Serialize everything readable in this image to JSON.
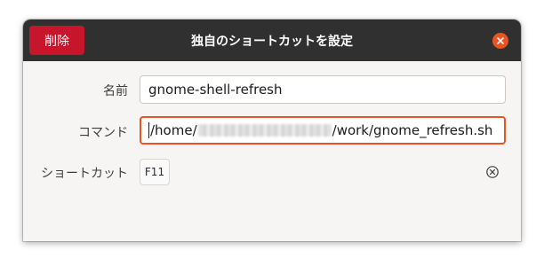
{
  "window": {
    "title": "独自のショートカットを設定",
    "delete_label": "削除"
  },
  "form": {
    "name_label": "名前",
    "name_value": "gnome-shell-refresh",
    "command_label": "コマンド",
    "command_prefix": "/home/",
    "command_suffix": "/work/gnome_refresh.sh",
    "shortcut_label": "ショートカット",
    "shortcut_value": "F11"
  },
  "colors": {
    "headerbar": "#303030",
    "destructive": "#c7162b",
    "accent": "#e95420"
  },
  "icons": {
    "close": "window-close-icon",
    "reset": "clear-shortcut-icon"
  }
}
